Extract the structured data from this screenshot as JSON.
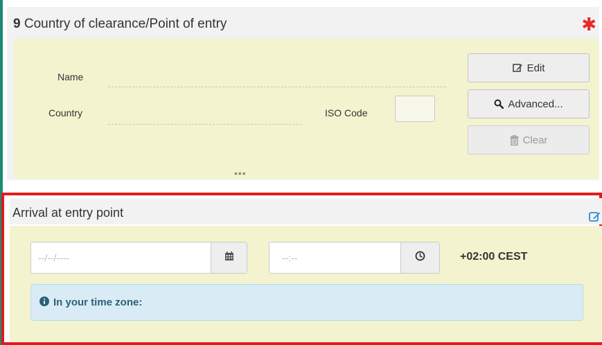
{
  "section9": {
    "number": "9",
    "title": "Country of clearance/Point of entry",
    "required_marker": "✱",
    "fields": {
      "name_label": "Name",
      "country_label": "Country",
      "iso_label": "ISO Code",
      "more": "•••"
    },
    "buttons": {
      "edit": "Edit",
      "advanced": "Advanced...",
      "clear": "Clear"
    }
  },
  "arrival": {
    "title": "Arrival at entry point",
    "date_placeholder": "--/--/----",
    "time_placeholder": "--:--",
    "timezone": "+02:00 CEST",
    "info_text": "In your time zone:"
  },
  "colors": {
    "panel_bg": "#f4f3d0",
    "highlight_border": "#e11b1b",
    "required": "#e52b2b",
    "info_bg": "#d9ecf5",
    "edit_icon": "#2d8bd6"
  },
  "icons": {
    "edit": "pencil-square-icon",
    "search": "search-icon",
    "clear": "trash-icon",
    "calendar": "calendar-icon",
    "clock": "clock-icon",
    "info": "info-circle-icon"
  }
}
